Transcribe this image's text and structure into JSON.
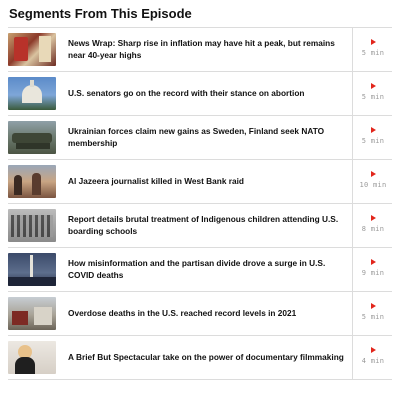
{
  "section": {
    "heading": "Segments From This Episode"
  },
  "segments": [
    {
      "title": "News Wrap: Sharp rise in inflation may have hit a peak, but remains near 40-year highs",
      "duration": "5 min",
      "thumb_icon": "grocery-store-thumbnail"
    },
    {
      "title": "U.S. senators go on the record with their stance on abortion",
      "duration": "5 min",
      "thumb_icon": "capitol-dome-thumbnail"
    },
    {
      "title": "Ukrainian forces claim new gains as Sweden, Finland seek NATO membership",
      "duration": "5 min",
      "thumb_icon": "military-vehicles-thumbnail"
    },
    {
      "title": "Al Jazeera journalist killed in West Bank raid",
      "duration": "10 min",
      "thumb_icon": "crowd-mourners-thumbnail"
    },
    {
      "title": "Report details brutal treatment of Indigenous children attending U.S. boarding schools",
      "duration": "8 min",
      "thumb_icon": "historical-photo-thumbnail"
    },
    {
      "title": "How misinformation and the partisan divide drove a surge in U.S. COVID deaths",
      "duration": "9 min",
      "thumb_icon": "washington-monument-thumbnail"
    },
    {
      "title": "Overdose deaths in the U.S. reached record levels in 2021",
      "duration": "5 min",
      "thumb_icon": "street-scene-thumbnail"
    },
    {
      "title": "A Brief But Spectacular take on the power of documentary filmmaking",
      "duration": "4 min",
      "thumb_icon": "filmmaker-portrait-thumbnail"
    }
  ],
  "colors": {
    "play_accent": "#e2261c",
    "duration_text": "#9a9a9a",
    "divider": "#dcdcdc"
  }
}
